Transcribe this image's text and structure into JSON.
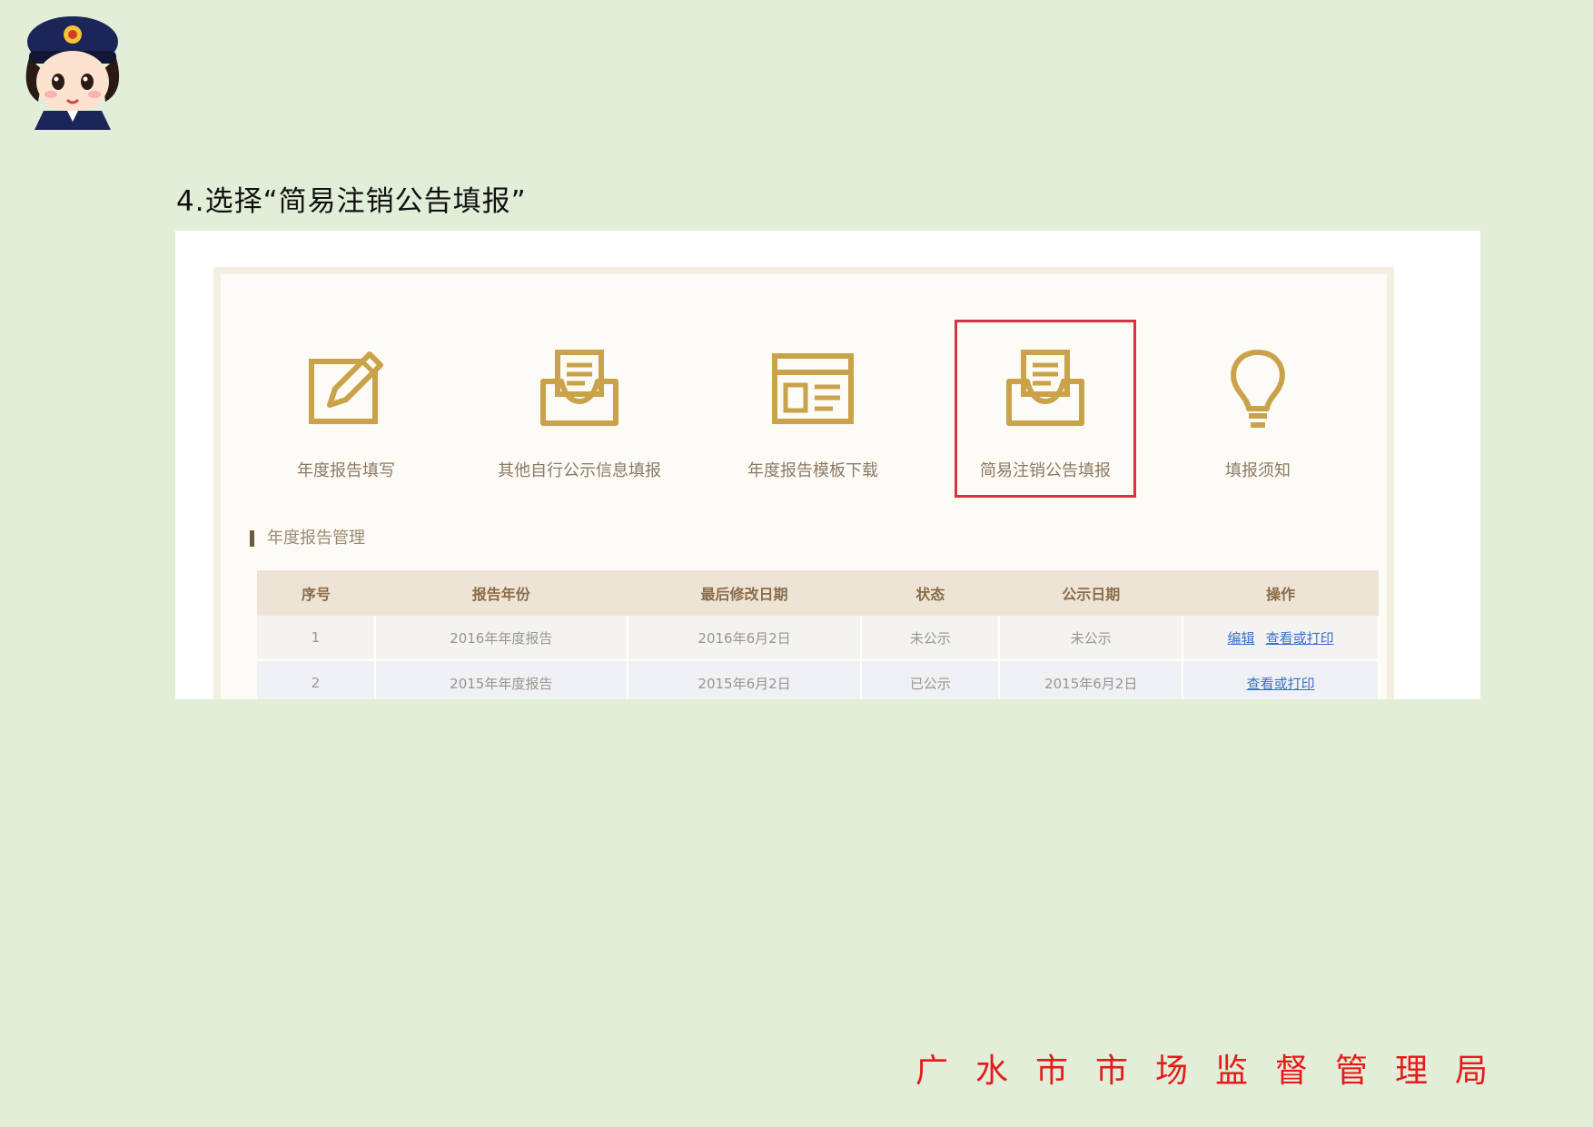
{
  "step_title": "4.选择“简易注销公告填报”",
  "menu": [
    {
      "label": "年度报告填写",
      "icon": "edit-pencil-icon"
    },
    {
      "label": "其他自行公示信息填报",
      "icon": "inbox-document-icon"
    },
    {
      "label": "年度报告模板下载",
      "icon": "browser-template-icon"
    },
    {
      "label": "简易注销公告填报",
      "icon": "inbox-document-icon",
      "selected": true
    },
    {
      "label": "填报须知",
      "icon": "lightbulb-icon"
    }
  ],
  "section_title": "年度报告管理",
  "table": {
    "headers": [
      "序号",
      "报告年份",
      "最后修改日期",
      "状态",
      "公示日期",
      "操作"
    ],
    "rows": [
      {
        "no": "1",
        "year": "2016年年度报告",
        "modified": "2016年6月2日",
        "status": "未公示",
        "publish": "未公示",
        "ops": [
          "编辑",
          "查看或打印"
        ]
      },
      {
        "no": "2",
        "year": "2015年年度报告",
        "modified": "2015年6月2日",
        "status": "已公示",
        "publish": "2015年6月2日",
        "ops": [
          "查看或打印"
        ]
      }
    ]
  },
  "footer": "广水市市场监督管理局",
  "colors": {
    "icon_gold": "#c9a24a",
    "highlight": "#d8333f",
    "footer_red": "#e61a1a",
    "background": "#e2eed8"
  }
}
